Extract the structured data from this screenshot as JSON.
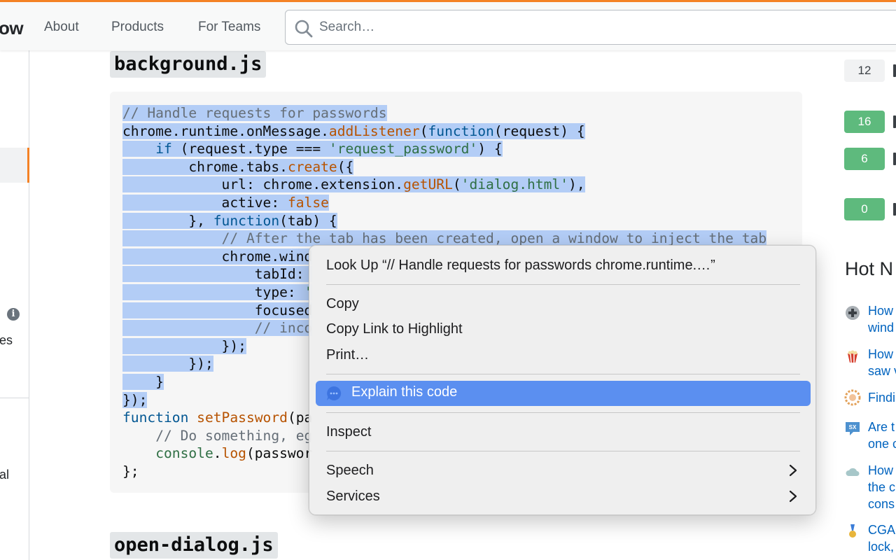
{
  "header": {
    "logo_fragment": "ow",
    "nav": [
      "About",
      "Products",
      "For Teams"
    ],
    "search_placeholder": "Search…"
  },
  "left_sidebar": {
    "fragments": [
      "es",
      "al"
    ]
  },
  "main": {
    "files": [
      {
        "name": "background.js"
      },
      {
        "name": "open-dialog.js"
      }
    ],
    "code_lines": [
      [
        {
          "t": "// Handle requests for passwords",
          "c": "cm"
        }
      ],
      [
        {
          "t": "chrome.runtime.onMessage.",
          "c": "plain"
        },
        {
          "t": "addListener",
          "c": "fn"
        },
        {
          "t": "(",
          "c": "plain"
        },
        {
          "t": "function",
          "c": "kw"
        },
        {
          "t": "(request) {",
          "c": "plain"
        }
      ],
      [
        {
          "t": "    ",
          "c": "plain"
        },
        {
          "t": "if",
          "c": "kw"
        },
        {
          "t": " (request.type === ",
          "c": "plain"
        },
        {
          "t": "'request_password'",
          "c": "str"
        },
        {
          "t": ") {",
          "c": "plain"
        }
      ],
      [
        {
          "t": "        chrome.tabs.",
          "c": "plain"
        },
        {
          "t": "create",
          "c": "fn"
        },
        {
          "t": "({",
          "c": "plain"
        }
      ],
      [
        {
          "t": "            url: chrome.extension.",
          "c": "plain"
        },
        {
          "t": "getURL",
          "c": "fn"
        },
        {
          "t": "(",
          "c": "plain"
        },
        {
          "t": "'dialog.html'",
          "c": "str"
        },
        {
          "t": "),",
          "c": "plain"
        }
      ],
      [
        {
          "t": "            active: ",
          "c": "plain"
        },
        {
          "t": "false",
          "c": "bool"
        }
      ],
      [
        {
          "t": "        }, ",
          "c": "plain"
        },
        {
          "t": "function",
          "c": "kw"
        },
        {
          "t": "(tab) {",
          "c": "plain"
        }
      ],
      [
        {
          "t": "            ",
          "c": "plain"
        },
        {
          "t": "// After the tab has been created, open a window to inject the tab",
          "c": "cm"
        }
      ],
      [
        {
          "t": "            chrome.wind",
          "c": "plain"
        }
      ],
      [
        {
          "t": "                tabId: ",
          "c": "plain"
        }
      ],
      [
        {
          "t": "                type: ",
          "c": "plain"
        },
        {
          "t": "'",
          "c": "str"
        }
      ],
      [
        {
          "t": "                focused",
          "c": "plain"
        }
      ],
      [
        {
          "t": "                ",
          "c": "plain"
        },
        {
          "t": "// inco",
          "c": "cm"
        }
      ],
      [
        {
          "t": "            });",
          "c": "plain"
        }
      ],
      [
        {
          "t": "        });",
          "c": "plain"
        }
      ],
      [
        {
          "t": "    }",
          "c": "plain"
        }
      ],
      [
        {
          "t": "});",
          "c": "plain"
        }
      ],
      [
        {
          "t": "function",
          "c": "kw"
        },
        {
          "t": " ",
          "c": "plain"
        },
        {
          "t": "setPassword",
          "c": "fn"
        },
        {
          "t": "(pa",
          "c": "plain"
        }
      ],
      [
        {
          "t": "    ",
          "c": "plain"
        },
        {
          "t": "// Do something, eg",
          "c": "cm"
        }
      ],
      [
        {
          "t": "    ",
          "c": "plain"
        },
        {
          "t": "console",
          "c": "str"
        },
        {
          "t": ".",
          "c": "plain"
        },
        {
          "t": "log",
          "c": "fn"
        },
        {
          "t": "(passwor",
          "c": "plain"
        }
      ],
      [
        {
          "t": "};",
          "c": "plain"
        }
      ]
    ],
    "selected_line_count": 17
  },
  "right_sidebar": {
    "votes": [
      "12",
      "16",
      "6",
      "0"
    ],
    "hot_title": "Hot N",
    "hot_items": [
      {
        "icon": "superuser-icon",
        "text": "How\nwind"
      },
      {
        "icon": "movies-icon",
        "text": "How\nsaw v"
      },
      {
        "icon": "puzzling-icon",
        "text": "Findi"
      },
      {
        "icon": "stackexchange-icon",
        "text": "Are t\none c"
      },
      {
        "icon": "weather-icon",
        "text": "How\nthe c\ncons"
      },
      {
        "icon": "codegolf-icon",
        "text": "CGAC\nlock,"
      }
    ]
  },
  "context_menu": {
    "look_up": "Look Up “// Handle requests for passwords chrome.runtime.…”",
    "copy": "Copy",
    "copy_link": "Copy Link to Highlight",
    "print": "Print…",
    "explain": "Explain this code",
    "inspect": "Inspect",
    "speech": "Speech",
    "services": "Services"
  },
  "colors": {
    "accent": "#f48225",
    "selection": "#b3cdf6",
    "menu_highlight": "#5b8ff0",
    "vote_green": "#5eba7d",
    "link": "#0063bf"
  }
}
